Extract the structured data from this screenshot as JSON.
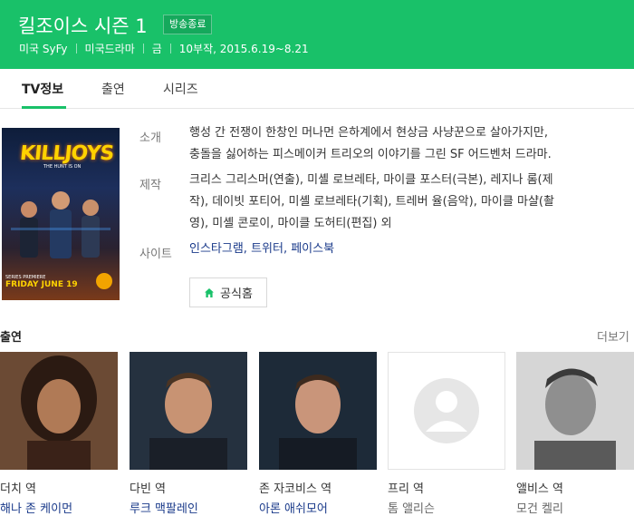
{
  "header": {
    "title": "킬조이스 시즌 1",
    "badge": "방송종료",
    "meta": [
      "미국 SyFy",
      "미국드라마",
      "금",
      "10부작, 2015.6.19~8.21"
    ]
  },
  "tabs": [
    {
      "label": "TV정보",
      "active": true
    },
    {
      "label": "출연",
      "active": false
    },
    {
      "label": "시리즈",
      "active": false
    }
  ],
  "poster": {
    "logo": "KILLJOYS",
    "tagline": "THE HUNT IS ON",
    "premiere": "SERIES PREMIERE",
    "date": "FRIDAY JUNE 19"
  },
  "info": {
    "intro_label": "소개",
    "intro_line1": "행성 간 전쟁이 한창인 머나먼 은하계에서 현상금 사냥꾼으로 살아가지만,",
    "intro_line2": "충돌을 싫어하는 피스메이커 트리오의 이야기를 그린 SF 어드벤처 드라마.",
    "production_label": "제작",
    "production": [
      {
        "name": "크리스 그리스머",
        "role": "(연출)"
      },
      {
        "name": "미셸 로브레타",
        "role": "(극본)"
      },
      {
        "name": "마이클 포스터",
        "role": "(극본)"
      },
      {
        "name": "레지나 롬",
        "role": "(제작)"
      },
      {
        "name": "데이빗 포티어",
        "role": "(기획)"
      },
      {
        "name": "미셸 로브레타",
        "role": "(기획)"
      },
      {
        "name": "트레버 율",
        "role": "(음악)"
      },
      {
        "name": "마이클 마샬",
        "role": "(촬영)"
      },
      {
        "name": "미셸 콘로이",
        "role": ""
      },
      {
        "name": "마이클 도허티",
        "role": "(편집)"
      }
    ],
    "production_line1": "크리스 그리스머(연출), 미셸 로브레타, 마이클 포스터(극본), 레지나 롬(제",
    "production_line2": "작), 데이빗 포티어, 미셸 로브레타(기획), 트레버 율(음악), 마이클 마샬(촬",
    "production_line3": "영), 미셸 콘로이, 마이클 도허티(편집) 외",
    "site_label": "사이트",
    "sites": "인스타그램, 트위터, 페이스북",
    "home_button": "공식홈"
  },
  "cast": {
    "title": "출연",
    "more": "더보기",
    "members": [
      {
        "role": "더치 역",
        "actor": "해나 존 케이먼",
        "linked": true
      },
      {
        "role": "다빈 역",
        "actor": "루크 맥팔레인",
        "linked": true
      },
      {
        "role": "존 자코비스 역",
        "actor": "아론 애쉬모어",
        "linked": true
      },
      {
        "role": "프리 역",
        "actor": "톰 앨리슨",
        "linked": false
      },
      {
        "role": "앨비스 역",
        "actor": "모건 켈리",
        "linked": false
      }
    ]
  },
  "colors": {
    "brand_green": "#19c169",
    "link_blue": "#1a3a8a"
  }
}
